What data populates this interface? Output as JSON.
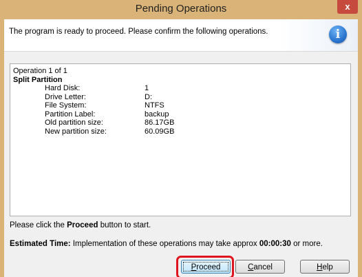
{
  "window": {
    "title": "Pending Operations",
    "close_glyph": "x"
  },
  "header": {
    "message": "The program is ready to proceed. Please confirm the following operations.",
    "icon": "info-icon",
    "icon_glyph": "i"
  },
  "operations": {
    "counter": "Operation 1 of 1",
    "type": "Split Partition",
    "details": [
      {
        "label": "Hard Disk:",
        "value": "1"
      },
      {
        "label": "Drive Letter:",
        "value": "D:"
      },
      {
        "label": "File System:",
        "value": "NTFS"
      },
      {
        "label": "Partition Label:",
        "value": "backup"
      },
      {
        "label": "Old partition size:",
        "value": "86.17GB"
      },
      {
        "label": "New partition size:",
        "value": "60.09GB"
      }
    ]
  },
  "instruction": {
    "before": "Please click the ",
    "bold": "Proceed",
    "after": " button to start."
  },
  "estimate": {
    "label": "Estimated Time:",
    "text_before": " Implementation of these operations may take approx ",
    "time": "00:00:30",
    "text_after": " or more."
  },
  "buttons": {
    "proceed_mnemonic": "P",
    "proceed_rest": "roceed",
    "cancel_mnemonic": "C",
    "cancel_rest": "ancel",
    "help_mnemonic": "H",
    "help_rest": "elp"
  },
  "colors": {
    "title_bar": "#d9b377",
    "close_button": "#c74a3f",
    "highlight": "#e0141f",
    "info_icon": "#2a76d0"
  }
}
